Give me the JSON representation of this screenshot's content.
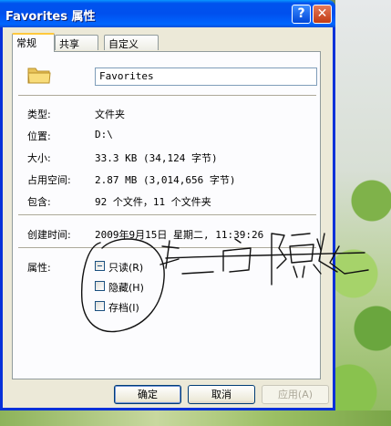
{
  "window": {
    "title": "Favorites 属性",
    "help_glyph": "?",
    "close_glyph": "✕"
  },
  "tabs": [
    {
      "label": "常规",
      "active": true
    },
    {
      "label": "共享",
      "active": false
    },
    {
      "label": "自定义",
      "active": false
    }
  ],
  "general": {
    "folder_name": "Favorites",
    "fields": {
      "type": {
        "label": "类型:",
        "value": "文件夹"
      },
      "location": {
        "label": "位置:",
        "value": "D:\\"
      },
      "size": {
        "label": "大小:",
        "value": "33.3 KB (34,124 字节)"
      },
      "size_on_disk": {
        "label": "占用空间:",
        "value": "2.87 MB (3,014,656 字节)"
      },
      "contains": {
        "label": "包含:",
        "value": "92 个文件，11 个文件夹"
      },
      "created": {
        "label": "创建时间:",
        "value": "2009年9月15日 星期二, 11:39:26"
      }
    },
    "attributes": {
      "label": "属性:",
      "items": [
        {
          "label": "只读(R)",
          "checked": "partial"
        },
        {
          "label": "隐藏(H)",
          "checked": false
        },
        {
          "label": "存档(I)",
          "checked": false
        }
      ]
    }
  },
  "buttons": {
    "ok": "确定",
    "cancel": "取消",
    "apply": "应用(A)"
  },
  "icons": {
    "folder": "folder-icon",
    "help": "help-icon",
    "close": "close-icon"
  },
  "colors": {
    "titlebar": "#0054e3",
    "dialog_bg": "#ece9d8",
    "panel_bg": "#fcfcfe",
    "tab_highlight": "#ffc83c"
  }
}
